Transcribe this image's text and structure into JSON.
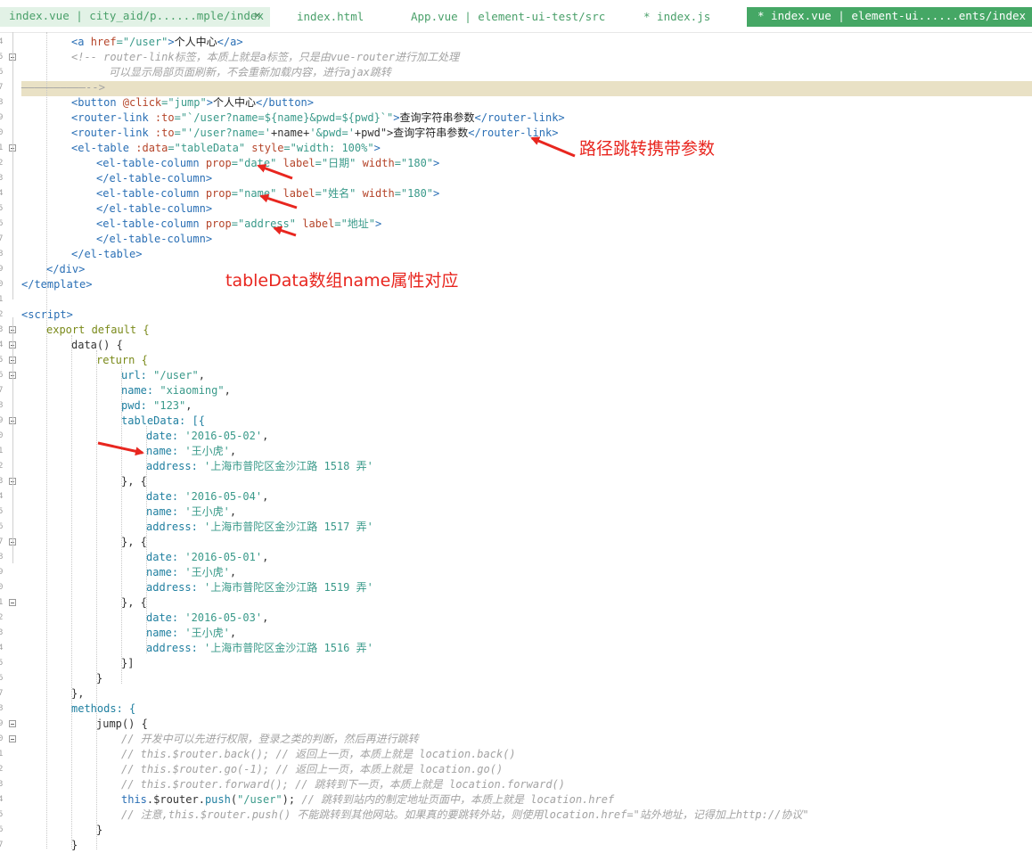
{
  "tabs": [
    {
      "label": "index.vue | city_aid/p......mple/index",
      "close": "✕"
    },
    {
      "label": "index.html"
    },
    {
      "label": "App.vue | element-ui-test/src"
    },
    {
      "label": "* index.js"
    },
    {
      "label": "* index.vue | element-ui......ents/index"
    }
  ],
  "line_numbers": [
    "4",
    "5",
    "6",
    "7",
    "8",
    "9",
    "0",
    "1",
    "2",
    "3",
    "4",
    "5",
    "6",
    "7",
    "8",
    "9",
    "0",
    "1",
    "2",
    "3",
    "4",
    "5",
    "6",
    "7",
    "8",
    "9",
    "0",
    "1",
    "2",
    "3",
    "4",
    "5",
    "6",
    "7",
    "8",
    "9",
    "0",
    "1",
    "2",
    "3",
    "4",
    "5",
    "6",
    "7",
    "8",
    "9",
    "0",
    "1",
    "2",
    "3",
    "4",
    "5",
    "6",
    "7",
    "8",
    "9"
  ],
  "code": {
    "l01": {
      "a": "<a ",
      "b": "href",
      "c": "=\"/user\"",
      "d": ">",
      "e": "个人中心",
      "f": "</a>"
    },
    "l02": "<!-- router-link标签，本质上就是a标签，只是由vue-router进行加工处理",
    "l03": "可以显示局部页面刷新，不会重新加载内容，进行ajax跳转",
    "l04": "-->",
    "l04dash": "——————————",
    "l05": {
      "a": "<button ",
      "b": "@click",
      "c": "=\"jump\"",
      "d": ">",
      "e": "个人中心",
      "f": "</button>"
    },
    "l06": {
      "a": "<router-link ",
      "b": ":to",
      "c": "=\"`/user?name=${name}&pwd=${pwd}`\"",
      "d": ">",
      "e": "查询字符串参数",
      "f": "</router-link>"
    },
    "l07": {
      "a": "<router-link ",
      "b": ":to",
      "c": "=\"'/user?name='",
      "d": "+name+",
      "e": "'&pwd='",
      "f": "+pwd\">",
      "g": "查询字符串参数",
      "h": "</router-link>"
    },
    "l08": {
      "a": "<el-table ",
      "b": ":data",
      "c": "=\"tableData\" ",
      "d": "style",
      "e": "=\"width: 100%\"",
      "f": ">"
    },
    "l09": {
      "a": "<el-table-column ",
      "b": "prop",
      "c": "=\"date\" ",
      "d": "label",
      "e": "=\"日期\" ",
      "f": "width",
      "g": "=\"180\"",
      "h": ">"
    },
    "l10": "</el-table-column>",
    "l11": {
      "a": "<el-table-column ",
      "b": "prop",
      "c": "=\"name\" ",
      "d": "label",
      "e": "=\"姓名\" ",
      "f": "width",
      "g": "=\"180\"",
      "h": ">"
    },
    "l12": "</el-table-column>",
    "l13": {
      "a": "<el-table-column ",
      "b": "prop",
      "c": "=\"address\" ",
      "d": "label",
      "e": "=\"地址\"",
      "f": ">"
    },
    "l14": "</el-table-column>",
    "l15": "</el-table>",
    "l16": "</div>",
    "l17": "</template>",
    "l19": "<script>",
    "l20": "export default {",
    "l21": "data() {",
    "l22": "return {",
    "l23": {
      "k": "url: ",
      "v": "\"/user\"",
      "e": ","
    },
    "l24": {
      "k": "name: ",
      "v": "\"xiaoming\"",
      "e": ","
    },
    "l25": {
      "k": "pwd: ",
      "v": "\"123\"",
      "e": ","
    },
    "l26": "tableData: [{",
    "rows": [
      {
        "date": "'2016-05-02'",
        "name": "'王小虎'",
        "address": "'上海市普陀区金沙江路 1518 弄'"
      },
      {
        "date": "'2016-05-04'",
        "name": "'王小虎'",
        "address": "'上海市普陀区金沙江路 1517 弄'"
      },
      {
        "date": "'2016-05-01'",
        "name": "'王小虎'",
        "address": "'上海市普陀区金沙江路 1519 弄'"
      },
      {
        "date": "'2016-05-03'",
        "name": "'王小虎'",
        "address": "'上海市普陀区金沙江路 1516 弄'"
      }
    ],
    "key_date": "date: ",
    "key_name": "name: ",
    "key_address": "address: ",
    "comma": ",",
    "sep": "}, {",
    "l43": "}]",
    "l44": "}",
    "l45": "},",
    "l46": "methods: {",
    "l47": "jump() {",
    "c1": "// 开发中可以先进行权限，登录之类的判断，然后再进行跳转",
    "c2": "// this.$router.back(); // 返回上一页，本质上就是 location.back()",
    "c3": "// this.$router.go(-1); // 返回上一页，本质上就是 location.go()",
    "c4": "// this.$router.forward(); // 跳转到下一页，本质上就是 location.forward()",
    "l52": {
      "a": "this",
      "b": ".$router.",
      "c": "push",
      "d": "(",
      "e": "\"/user\"",
      "f": "); ",
      "g": "// 跳转到站内的制定地址页面中，本质上就是 location.href"
    },
    "c6": "// 注意,this.$router.push() 不能跳转到其他网站。如果真的要跳转外站，则使用location.href=\"站外地址，记得加上http://协议\"",
    "l54": "}",
    "l55": "}"
  },
  "annotations": {
    "route": "路径跳转携带参数",
    "table": "tableData数组name属性对应"
  },
  "colors": {
    "tag": "#2a6fb5",
    "attr": "#b5452a",
    "string": "#3a9a8a",
    "comment": "#a3a3a3",
    "keyword": "#7a8a1a",
    "annotation": "#e8261f",
    "active_tab": "#45a765",
    "highlight_row": "#e9e1c5"
  }
}
